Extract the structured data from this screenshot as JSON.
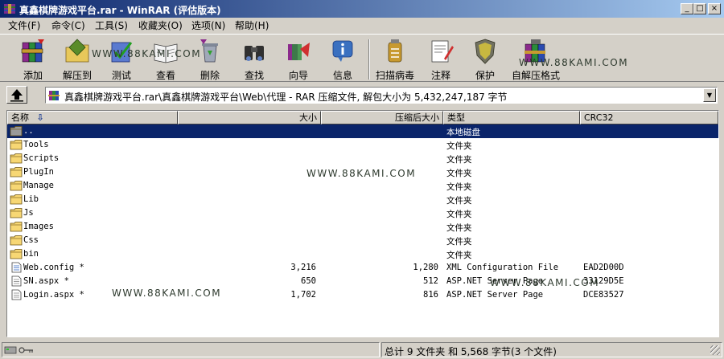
{
  "window": {
    "title": "真鑫棋牌游戏平台.rar - WinRAR (评估版本)",
    "minimize": "_",
    "maximize": "□",
    "close": "×"
  },
  "menu": [
    "文件(F)",
    "命令(C)",
    "工具(S)",
    "收藏夹(O)",
    "选项(N)",
    "帮助(H)"
  ],
  "toolbar": {
    "add": "添加",
    "extract_to": "解压到",
    "test": "测试",
    "view": "查看",
    "delete": "删除",
    "find": "查找",
    "wizard": "向导",
    "info": "信息",
    "virus_scan": "扫描病毒",
    "comment": "注释",
    "protect": "保护",
    "sfx": "自解压格式"
  },
  "path": {
    "text": "真鑫棋牌游戏平台.rar\\真鑫棋牌游戏平台\\Web\\代理 - RAR 压缩文件, 解包大小为 5,432,247,187 字节",
    "dropdown": "▼"
  },
  "columns": {
    "name": "名称",
    "size": "大小",
    "packed": "压缩后大小",
    "type": "类型",
    "crc": "CRC32"
  },
  "files": [
    {
      "name": "..",
      "size": "",
      "packed": "",
      "type": "本地磁盘",
      "crc": "",
      "icon": "folder-up-icon"
    },
    {
      "name": "Tools",
      "size": "",
      "packed": "",
      "type": "文件夹",
      "crc": "",
      "icon": "folder-icon"
    },
    {
      "name": "Scripts",
      "size": "",
      "packed": "",
      "type": "文件夹",
      "crc": "",
      "icon": "folder-icon"
    },
    {
      "name": "PlugIn",
      "size": "",
      "packed": "",
      "type": "文件夹",
      "crc": "",
      "icon": "folder-icon"
    },
    {
      "name": "Manage",
      "size": "",
      "packed": "",
      "type": "文件夹",
      "crc": "",
      "icon": "folder-icon"
    },
    {
      "name": "Lib",
      "size": "",
      "packed": "",
      "type": "文件夹",
      "crc": "",
      "icon": "folder-icon"
    },
    {
      "name": "Js",
      "size": "",
      "packed": "",
      "type": "文件夹",
      "crc": "",
      "icon": "folder-icon"
    },
    {
      "name": "Images",
      "size": "",
      "packed": "",
      "type": "文件夹",
      "crc": "",
      "icon": "folder-icon"
    },
    {
      "name": "Css",
      "size": "",
      "packed": "",
      "type": "文件夹",
      "crc": "",
      "icon": "folder-icon"
    },
    {
      "name": "bin",
      "size": "",
      "packed": "",
      "type": "文件夹",
      "crc": "",
      "icon": "folder-icon"
    },
    {
      "name": "Web.config *",
      "size": "3,216",
      "packed": "1,280",
      "type": "XML Configuration File",
      "crc": "EAD2D00D",
      "icon": "config-file-icon"
    },
    {
      "name": "SN.aspx *",
      "size": "650",
      "packed": "512",
      "type": "ASP.NET Server Page",
      "crc": "33129D5E",
      "icon": "aspx-file-icon"
    },
    {
      "name": "Login.aspx *",
      "size": "1,702",
      "packed": "816",
      "type": "ASP.NET Server Page",
      "crc": "DCE83527",
      "icon": "aspx-file-icon"
    }
  ],
  "watermark": "WWW.88KAMI.COM",
  "status": {
    "summary": "总计 9 文件夹 和 5,568 字节(3 个文件)"
  },
  "colors": {
    "titlebar_start": "#0a246a",
    "titlebar_end": "#a6caf0",
    "selection": "#0a246a",
    "folder": "#f7d774"
  }
}
